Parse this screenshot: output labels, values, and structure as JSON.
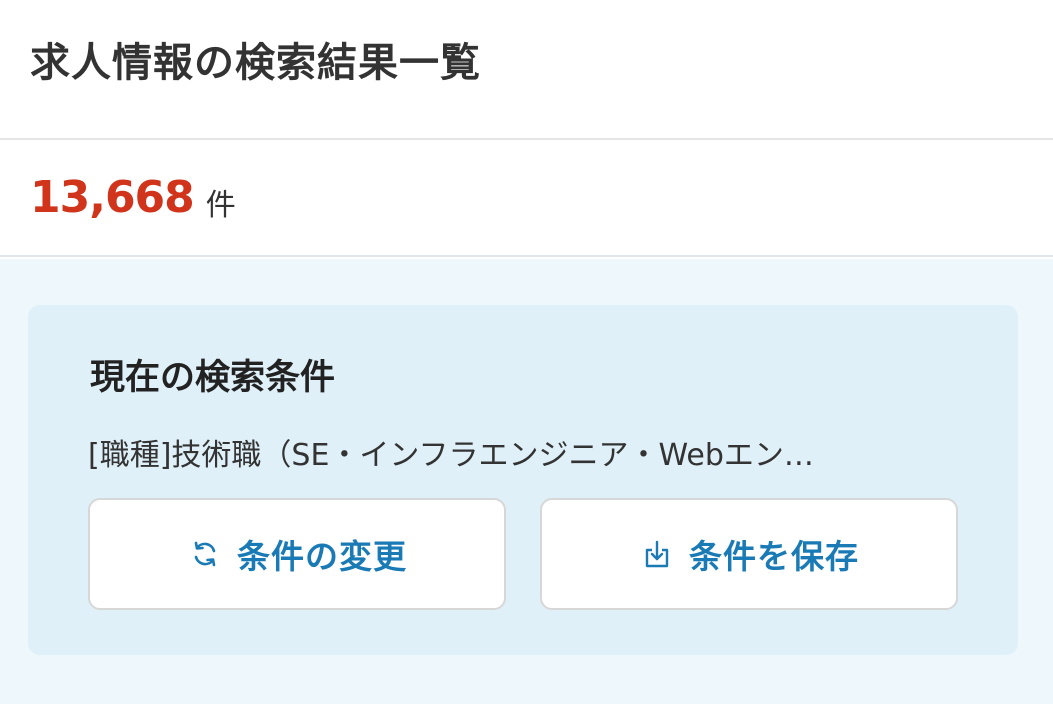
{
  "header": {
    "title": "求人情報の検索結果一覧"
  },
  "results": {
    "count": "13,668",
    "unit": "件"
  },
  "conditions": {
    "heading": "現在の検索条件",
    "summary": "[職種]技術職（SE・インフラエンジニア・Webエン…",
    "change_label": "条件の変更",
    "save_label": "条件を保存",
    "change_icon": "refresh-icon",
    "save_icon": "download-icon"
  },
  "colors": {
    "accent": "#1a7ab5",
    "count": "#d0341b",
    "panel_bg": "#dff0f8",
    "area_bg": "#eef7fb"
  }
}
